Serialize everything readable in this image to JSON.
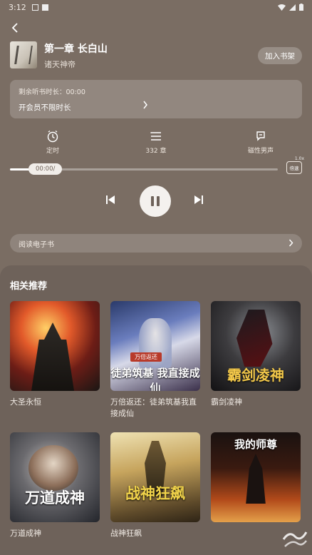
{
  "colors": {
    "background": "#7a6d63",
    "panel": "#6e625a",
    "accent": "#f4f1ee"
  },
  "status_bar": {
    "time": "3:12"
  },
  "header": {
    "chapter_title": "第一章 长白山",
    "book_title": "诸天神帝",
    "add_to_shelf": "加入书架"
  },
  "vip": {
    "remaining": "剩余听书时长：00:00",
    "unlimited": "开会员不限时长"
  },
  "controls": [
    {
      "label": "定时",
      "icon": "timer-icon"
    },
    {
      "label": "332 章",
      "icon": "list-icon"
    },
    {
      "label": "磁性男声",
      "icon": "voice-icon"
    }
  ],
  "player": {
    "time": "00:00/",
    "progress": 0.1,
    "speed_label": "倍速",
    "speed_value": "1.0x"
  },
  "ebook": {
    "label": "阅读电子书"
  },
  "recommendations": {
    "title": "相关推荐",
    "books": [
      {
        "name": "大圣永恒",
        "cover_text": ""
      },
      {
        "name": "万倍返还：徒弟筑基我直接成仙",
        "cover_text": "徒弟筑基 我直接成仙",
        "banner": "万倍返还"
      },
      {
        "name": "霸剑凌神",
        "cover_text": "霸剑凌神"
      },
      {
        "name": "万道成神",
        "cover_text": "万道成神"
      },
      {
        "name": "战神狂飙",
        "cover_text": "战神狂飙"
      },
      {
        "name": "",
        "cover_text": "我的师尊"
      }
    ]
  }
}
